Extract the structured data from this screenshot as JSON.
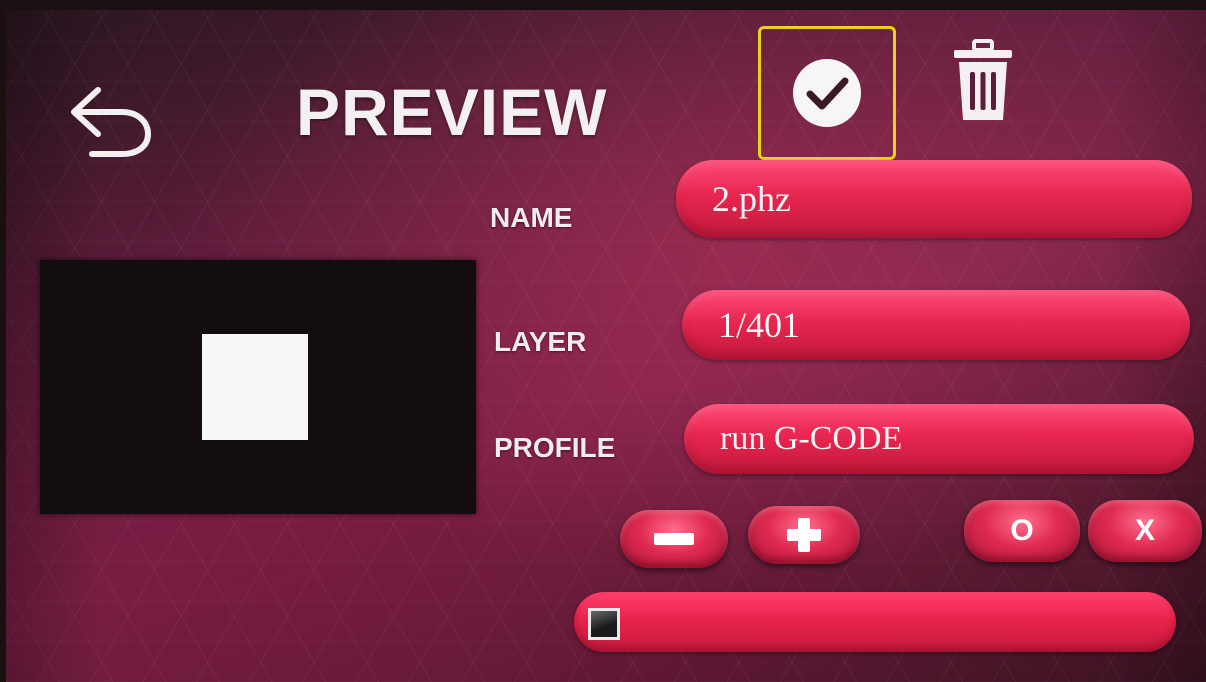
{
  "header": {
    "back_icon": "back-arrow-icon",
    "title": "PREVIEW",
    "confirm_icon": "checkmark-circle-icon",
    "delete_icon": "trash-icon",
    "highlight_color": "#e8d21a"
  },
  "preview": {
    "background_color": "#140d10",
    "shape_color": "#f7f7f7"
  },
  "fields": {
    "name": {
      "label": "NAME",
      "value": "2.phz"
    },
    "layer": {
      "label": "LAYER",
      "value": "1/401"
    },
    "profile": {
      "label": "PROFILE",
      "value": "run G-CODE"
    }
  },
  "controls": {
    "minus_icon": "minus-icon",
    "plus_icon": "plus-icon",
    "o_label": "O",
    "x_label": "X"
  },
  "progress": {
    "fraction": 0.0
  },
  "colors": {
    "accent": "#e8264f",
    "text": "#f4f0f2"
  }
}
